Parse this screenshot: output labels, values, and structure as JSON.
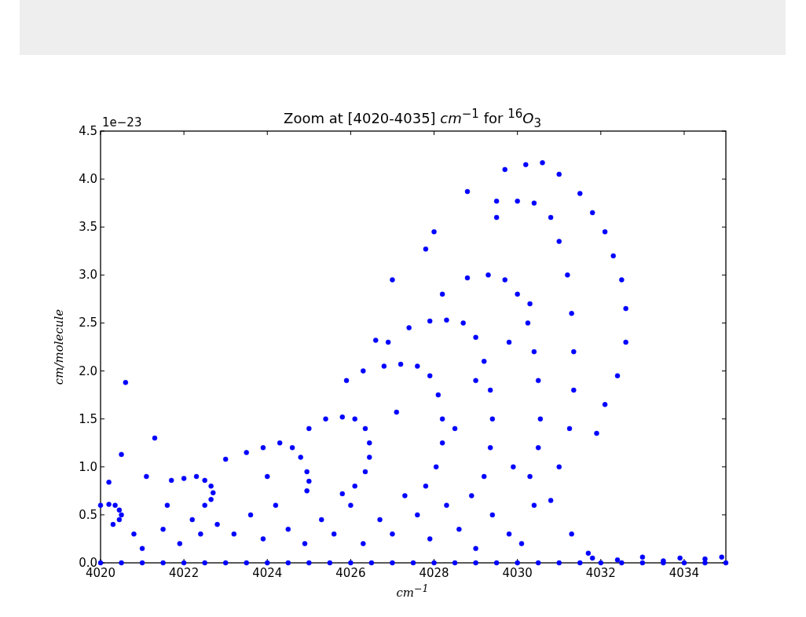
{
  "figure": {
    "chart_data": {
      "type": "scatter",
      "title": "Zoom at [4020-4035] *cm*$^{−1}$  for $^{16}$*O*$_{3}$",
      "xlabel": "cm$^{−1}$",
      "ylabel": "cm/molecule",
      "x": [
        4020.0,
        4020.2,
        4020.35,
        4020.45,
        4020.5,
        4020.45,
        4020.3,
        4021.7,
        4022.0,
        4022.3,
        4022.5,
        4022.65,
        4022.7,
        4022.65,
        4022.5,
        4023.5,
        4023.9,
        4024.3,
        4024.6,
        4024.8,
        4024.95,
        4025.0,
        4024.95,
        4025.0,
        4025.4,
        4025.8,
        4026.1,
        4026.35,
        4026.45,
        4026.45,
        4026.35,
        4026.1,
        4025.8,
        4025.9,
        4026.3,
        4026.8,
        4027.2,
        4027.6,
        4027.9,
        4028.1,
        4028.2,
        4028.2,
        4028.05,
        4027.8,
        4026.9,
        4027.4,
        4027.9,
        4028.3,
        4028.7,
        4029.0,
        4029.2,
        4029.35,
        4029.4,
        4029.35,
        4029.2,
        4028.9,
        4028.2,
        4028.8,
        4029.3,
        4029.7,
        4030.0,
        4030.25,
        4030.4,
        4030.5,
        4030.55,
        4030.5,
        4030.3,
        4029.5,
        4030.0,
        4030.4,
        4030.8,
        4031.0,
        4031.2,
        4031.3,
        4031.35,
        4031.35,
        4031.25,
        4031.0,
        4029.7,
        4030.2,
        4030.6,
        4031.0,
        4031.5,
        4031.8,
        4032.1,
        4032.3,
        4032.5,
        4032.6,
        4032.6,
        4032.4,
        4032.1,
        4031.9,
        4020.6,
        4021.3,
        4020.5,
        4020.2,
        4021.1,
        4020.8,
        4021.0,
        4021.5,
        4021.9,
        4022.2,
        4022.8,
        4023.2,
        4023.6,
        4023.9,
        4024.2,
        4024.5,
        4024.9,
        4025.3,
        4025.6,
        4026.0,
        4026.3,
        4026.7,
        4027.0,
        4027.3,
        4027.6,
        4027.9,
        4028.3,
        4028.6,
        4029.0,
        4029.4,
        4029.8,
        4030.1,
        4030.4,
        4031.3,
        4031.7,
        4027.1,
        4026.6,
        4027.0,
        4027.8,
        4028.0,
        4028.8,
        4029.5,
        4030.3,
        4029.8,
        4029.0,
        4028.5,
        4029.9,
        4030.8,
        4024.0,
        4023.0,
        4022.4,
        4021.6,
        4020.0,
        4020.5,
        4021.0,
        4021.5,
        4022.0,
        4022.5,
        4023.0,
        4023.5,
        4024.0,
        4024.5,
        4025.0,
        4025.5,
        4026.0,
        4026.5,
        4027.0,
        4027.5,
        4028.0,
        4028.5,
        4029.0,
        4029.5,
        4030.0,
        4030.5,
        4031.0,
        4031.5,
        4032.0,
        4032.5,
        4033.0,
        4033.5,
        4034.0,
        4034.5,
        4035.0,
        4031.8,
        4032.4,
        4033.0,
        4033.9,
        4034.5,
        4034.9,
        4033.5
      ],
      "series": [
        {
          "color": "#0000ff",
          "values": [
            0.6,
            0.61,
            0.6,
            0.55,
            0.5,
            0.45,
            0.4,
            0.86,
            0.88,
            0.9,
            0.86,
            0.8,
            0.73,
            0.66,
            0.6,
            1.15,
            1.2,
            1.25,
            1.2,
            1.1,
            0.95,
            0.85,
            0.75,
            1.4,
            1.5,
            1.52,
            1.5,
            1.4,
            1.25,
            1.1,
            0.95,
            0.8,
            0.72,
            1.9,
            2.0,
            2.05,
            2.07,
            2.05,
            1.95,
            1.75,
            1.5,
            1.25,
            1.0,
            0.8,
            2.3,
            2.45,
            2.52,
            2.53,
            2.5,
            2.35,
            2.1,
            1.8,
            1.5,
            1.2,
            0.9,
            0.7,
            2.8,
            2.97,
            3.0,
            2.95,
            2.8,
            2.5,
            2.2,
            1.9,
            1.5,
            1.2,
            0.9,
            3.6,
            3.77,
            3.75,
            3.6,
            3.35,
            3.0,
            2.6,
            2.2,
            1.8,
            1.4,
            1.0,
            4.1,
            4.15,
            4.17,
            4.05,
            3.85,
            3.65,
            3.45,
            3.2,
            2.95,
            2.65,
            2.3,
            1.95,
            1.65,
            1.35,
            1.88,
            1.3,
            1.13,
            0.84,
            0.9,
            0.3,
            0.15,
            0.35,
            0.2,
            0.45,
            0.4,
            0.3,
            0.5,
            0.25,
            0.6,
            0.35,
            0.2,
            0.45,
            0.3,
            0.6,
            0.2,
            0.45,
            0.3,
            0.7,
            0.5,
            0.25,
            0.6,
            0.35,
            0.15,
            0.5,
            0.3,
            0.2,
            0.6,
            0.3,
            0.1,
            1.57,
            2.32,
            2.95,
            3.27,
            3.45,
            3.87,
            3.77,
            2.7,
            2.3,
            1.9,
            1.4,
            1.0,
            0.65,
            0.9,
            1.08,
            0.3,
            0.6,
            0,
            0,
            0,
            0,
            0,
            0,
            0,
            0,
            0,
            0,
            0,
            0,
            0,
            0,
            0,
            0,
            0,
            0,
            0,
            0,
            0,
            0,
            0,
            0,
            0,
            0,
            0,
            0,
            0,
            0,
            0,
            0.05,
            0.03,
            0.06,
            0.05,
            0.04,
            0.06,
            0.02
          ]
        }
      ],
      "xlim": [
        4020,
        4035
      ],
      "ylim": [
        0,
        4.5
      ],
      "xticks": [
        4020,
        4022,
        4024,
        4026,
        4028,
        4030,
        4032,
        4034
      ],
      "yticks": [
        {
          "value": 0,
          "label": "0.0"
        },
        {
          "value": 0.5,
          "label": "0.5"
        },
        {
          "value": 1,
          "label": "1.0"
        },
        {
          "value": 1.5,
          "label": "1.5"
        },
        {
          "value": 2,
          "label": "2.0"
        },
        {
          "value": 2.5,
          "label": "2.5"
        },
        {
          "value": 3,
          "label": "3.0"
        },
        {
          "value": 3.5,
          "label": "3.5"
        },
        {
          "value": 4,
          "label": "4.0"
        },
        {
          "value": 4.5,
          "label": "4.5"
        }
      ],
      "annotations": [
        {
          "text": "1e−23"
        }
      ]
    }
  }
}
